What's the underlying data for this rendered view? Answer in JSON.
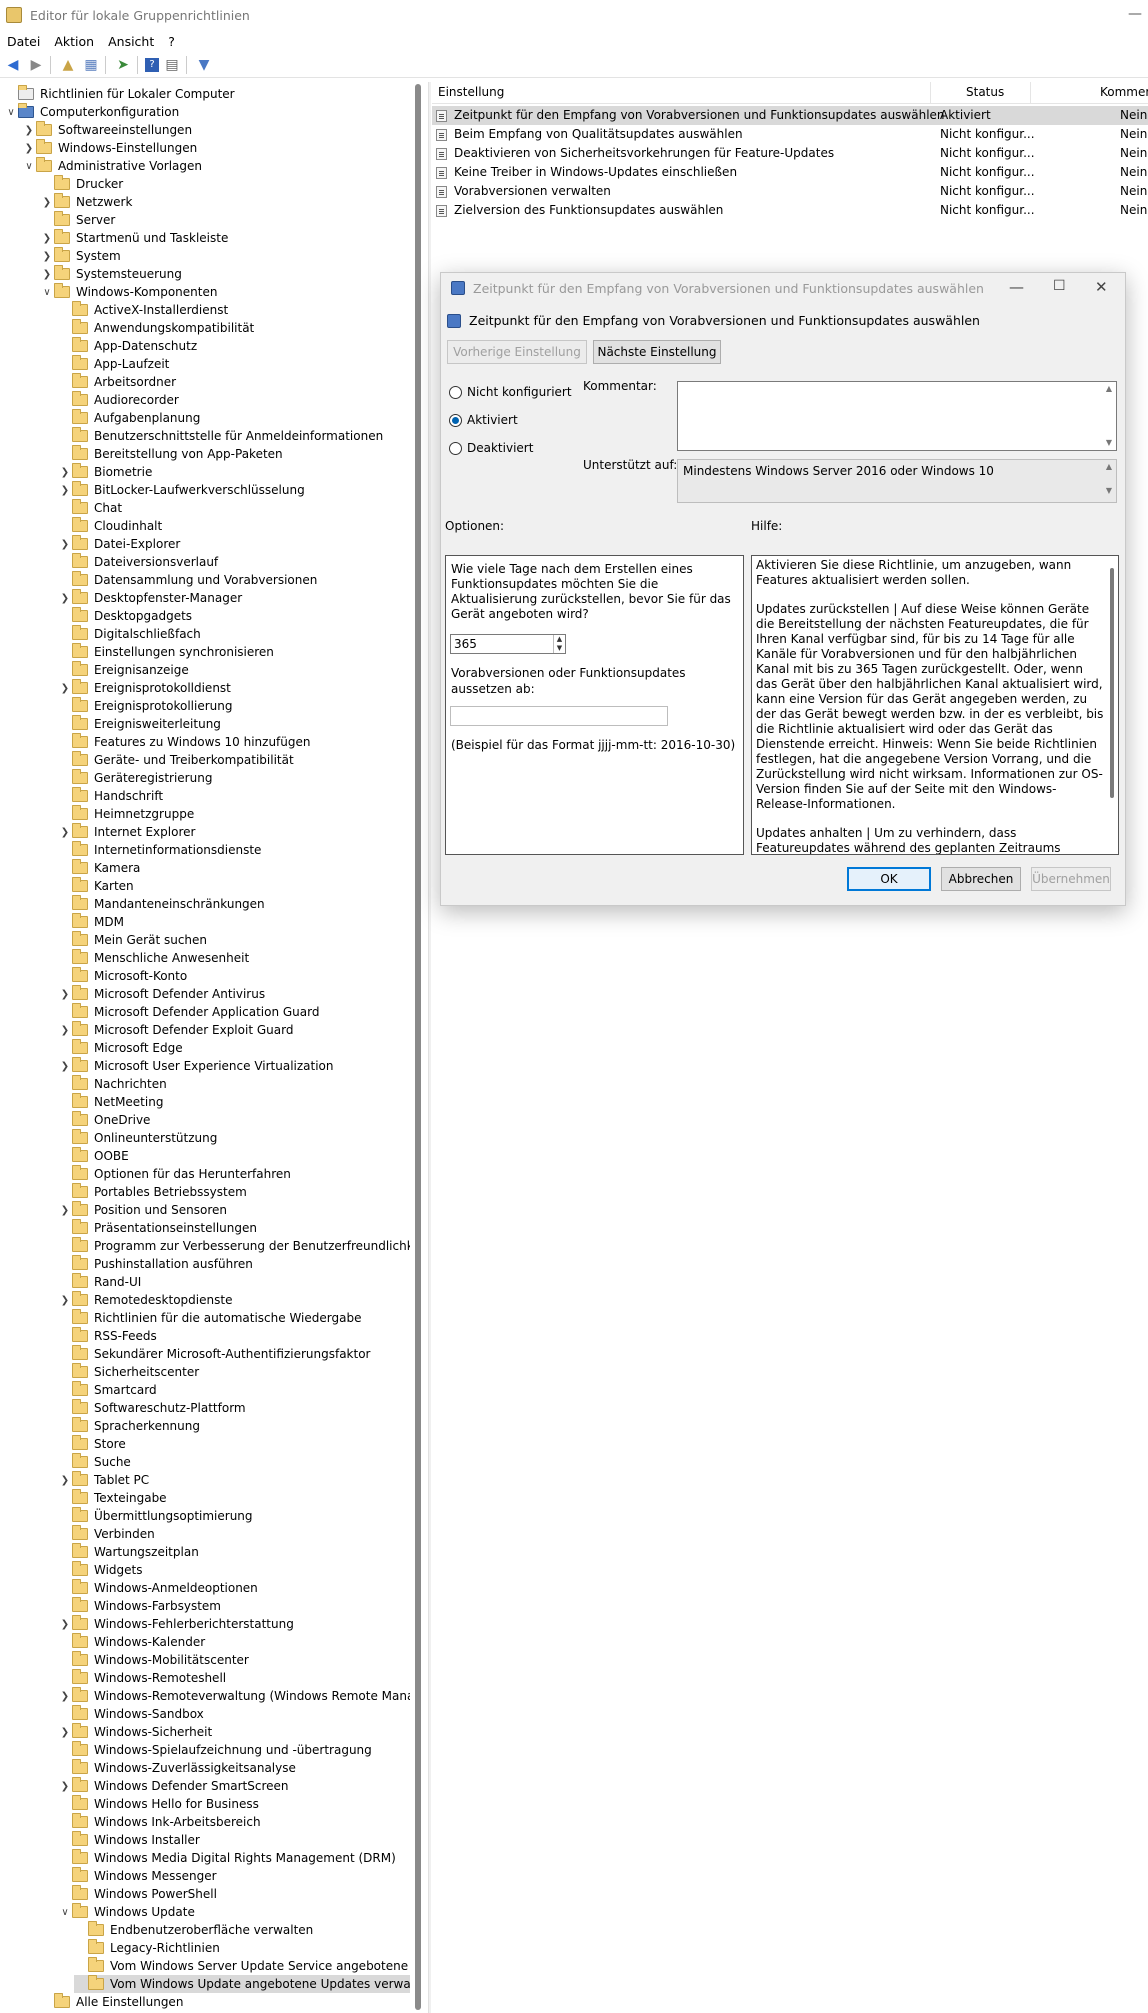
{
  "window": {
    "title": "Editor für lokale Gruppenrichtlinien",
    "minimize": "—"
  },
  "menu": [
    "Datei",
    "Aktion",
    "Ansicht",
    "?"
  ],
  "tree": [
    {
      "label": "Richtlinien für Lokaler Computer",
      "level": 0,
      "arrow": "",
      "icon": "computer-policy"
    },
    {
      "label": "Computerkonfiguration",
      "level": 0,
      "arrow": "v",
      "icon": "computer"
    },
    {
      "label": "Softwareeinstellungen",
      "level": 1,
      "arrow": ">",
      "icon": "folder"
    },
    {
      "label": "Windows-Einstellungen",
      "level": 1,
      "arrow": ">",
      "icon": "folder"
    },
    {
      "label": "Administrative Vorlagen",
      "level": 1,
      "arrow": "v",
      "icon": "folder"
    },
    {
      "label": "Drucker",
      "level": 2,
      "arrow": "",
      "icon": "folder"
    },
    {
      "label": "Netzwerk",
      "level": 2,
      "arrow": ">",
      "icon": "folder"
    },
    {
      "label": "Server",
      "level": 2,
      "arrow": "",
      "icon": "folder"
    },
    {
      "label": "Startmenü und Taskleiste",
      "level": 2,
      "arrow": ">",
      "icon": "folder"
    },
    {
      "label": "System",
      "level": 2,
      "arrow": ">",
      "icon": "folder"
    },
    {
      "label": "Systemsteuerung",
      "level": 2,
      "arrow": ">",
      "icon": "folder"
    },
    {
      "label": "Windows-Komponenten",
      "level": 2,
      "arrow": "v",
      "icon": "folder"
    },
    {
      "label": "ActiveX-Installerdienst",
      "level": 3,
      "arrow": "",
      "icon": "folder"
    },
    {
      "label": "Anwendungskompatibilität",
      "level": 3,
      "arrow": "",
      "icon": "folder"
    },
    {
      "label": "App-Datenschutz",
      "level": 3,
      "arrow": "",
      "icon": "folder"
    },
    {
      "label": "App-Laufzeit",
      "level": 3,
      "arrow": "",
      "icon": "folder"
    },
    {
      "label": "Arbeitsordner",
      "level": 3,
      "arrow": "",
      "icon": "folder"
    },
    {
      "label": "Audiorecorder",
      "level": 3,
      "arrow": "",
      "icon": "folder"
    },
    {
      "label": "Aufgabenplanung",
      "level": 3,
      "arrow": "",
      "icon": "folder"
    },
    {
      "label": "Benutzerschnittstelle für Anmeldeinformationen",
      "level": 3,
      "arrow": "",
      "icon": "folder"
    },
    {
      "label": "Bereitstellung von App-Paketen",
      "level": 3,
      "arrow": "",
      "icon": "folder"
    },
    {
      "label": "Biometrie",
      "level": 3,
      "arrow": ">",
      "icon": "folder"
    },
    {
      "label": "BitLocker-Laufwerkverschlüsselung",
      "level": 3,
      "arrow": ">",
      "icon": "folder"
    },
    {
      "label": "Chat",
      "level": 3,
      "arrow": "",
      "icon": "folder"
    },
    {
      "label": "Cloudinhalt",
      "level": 3,
      "arrow": "",
      "icon": "folder"
    },
    {
      "label": "Datei-Explorer",
      "level": 3,
      "arrow": ">",
      "icon": "folder"
    },
    {
      "label": "Dateiversionsverlauf",
      "level": 3,
      "arrow": "",
      "icon": "folder"
    },
    {
      "label": "Datensammlung und Vorabversionen",
      "level": 3,
      "arrow": "",
      "icon": "folder"
    },
    {
      "label": "Desktopfenster-Manager",
      "level": 3,
      "arrow": ">",
      "icon": "folder"
    },
    {
      "label": "Desktopgadgets",
      "level": 3,
      "arrow": "",
      "icon": "folder"
    },
    {
      "label": "Digitalschließfach",
      "level": 3,
      "arrow": "",
      "icon": "folder"
    },
    {
      "label": "Einstellungen synchronisieren",
      "level": 3,
      "arrow": "",
      "icon": "folder"
    },
    {
      "label": "Ereignisanzeige",
      "level": 3,
      "arrow": "",
      "icon": "folder"
    },
    {
      "label": "Ereignisprotokolldienst",
      "level": 3,
      "arrow": ">",
      "icon": "folder"
    },
    {
      "label": "Ereignisprotokollierung",
      "level": 3,
      "arrow": "",
      "icon": "folder"
    },
    {
      "label": "Ereignisweiterleitung",
      "level": 3,
      "arrow": "",
      "icon": "folder"
    },
    {
      "label": "Features zu Windows 10 hinzufügen",
      "level": 3,
      "arrow": "",
      "icon": "folder"
    },
    {
      "label": "Geräte- und Treiberkompatibilität",
      "level": 3,
      "arrow": "",
      "icon": "folder"
    },
    {
      "label": "Geräteregistrierung",
      "level": 3,
      "arrow": "",
      "icon": "folder"
    },
    {
      "label": "Handschrift",
      "level": 3,
      "arrow": "",
      "icon": "folder"
    },
    {
      "label": "Heimnetzgruppe",
      "level": 3,
      "arrow": "",
      "icon": "folder"
    },
    {
      "label": "Internet Explorer",
      "level": 3,
      "arrow": ">",
      "icon": "folder"
    },
    {
      "label": "Internetinformationsdienste",
      "level": 3,
      "arrow": "",
      "icon": "folder"
    },
    {
      "label": "Kamera",
      "level": 3,
      "arrow": "",
      "icon": "folder"
    },
    {
      "label": "Karten",
      "level": 3,
      "arrow": "",
      "icon": "folder"
    },
    {
      "label": "Mandanteneinschränkungen",
      "level": 3,
      "arrow": "",
      "icon": "folder"
    },
    {
      "label": "MDM",
      "level": 3,
      "arrow": "",
      "icon": "folder"
    },
    {
      "label": "Mein Gerät suchen",
      "level": 3,
      "arrow": "",
      "icon": "folder"
    },
    {
      "label": "Menschliche Anwesenheit",
      "level": 3,
      "arrow": "",
      "icon": "folder"
    },
    {
      "label": "Microsoft-Konto",
      "level": 3,
      "arrow": "",
      "icon": "folder"
    },
    {
      "label": "Microsoft Defender Antivirus",
      "level": 3,
      "arrow": ">",
      "icon": "folder"
    },
    {
      "label": "Microsoft Defender Application Guard",
      "level": 3,
      "arrow": "",
      "icon": "folder"
    },
    {
      "label": "Microsoft Defender Exploit Guard",
      "level": 3,
      "arrow": ">",
      "icon": "folder"
    },
    {
      "label": "Microsoft Edge",
      "level": 3,
      "arrow": "",
      "icon": "folder"
    },
    {
      "label": "Microsoft User Experience Virtualization",
      "level": 3,
      "arrow": ">",
      "icon": "folder"
    },
    {
      "label": "Nachrichten",
      "level": 3,
      "arrow": "",
      "icon": "folder"
    },
    {
      "label": "NetMeeting",
      "level": 3,
      "arrow": "",
      "icon": "folder"
    },
    {
      "label": "OneDrive",
      "level": 3,
      "arrow": "",
      "icon": "folder"
    },
    {
      "label": "Onlineunterstützung",
      "level": 3,
      "arrow": "",
      "icon": "folder"
    },
    {
      "label": "OOBE",
      "level": 3,
      "arrow": "",
      "icon": "folder"
    },
    {
      "label": "Optionen für das Herunterfahren",
      "level": 3,
      "arrow": "",
      "icon": "folder"
    },
    {
      "label": "Portables Betriebssystem",
      "level": 3,
      "arrow": "",
      "icon": "folder"
    },
    {
      "label": "Position und Sensoren",
      "level": 3,
      "arrow": ">",
      "icon": "folder"
    },
    {
      "label": "Präsentationseinstellungen",
      "level": 3,
      "arrow": "",
      "icon": "folder"
    },
    {
      "label": "Programm zur Verbesserung der Benutzerfreundlichkeit",
      "level": 3,
      "arrow": "",
      "icon": "folder"
    },
    {
      "label": "Pushinstallation ausführen",
      "level": 3,
      "arrow": "",
      "icon": "folder"
    },
    {
      "label": "Rand-UI",
      "level": 3,
      "arrow": "",
      "icon": "folder"
    },
    {
      "label": "Remotedesktopdienste",
      "level": 3,
      "arrow": ">",
      "icon": "folder"
    },
    {
      "label": "Richtlinien für die automatische Wiedergabe",
      "level": 3,
      "arrow": "",
      "icon": "folder"
    },
    {
      "label": "RSS-Feeds",
      "level": 3,
      "arrow": "",
      "icon": "folder"
    },
    {
      "label": "Sekundärer Microsoft-Authentifizierungsfaktor",
      "level": 3,
      "arrow": "",
      "icon": "folder"
    },
    {
      "label": "Sicherheitscenter",
      "level": 3,
      "arrow": "",
      "icon": "folder"
    },
    {
      "label": "Smartcard",
      "level": 3,
      "arrow": "",
      "icon": "folder"
    },
    {
      "label": "Softwareschutz-Plattform",
      "level": 3,
      "arrow": "",
      "icon": "folder"
    },
    {
      "label": "Spracherkennung",
      "level": 3,
      "arrow": "",
      "icon": "folder"
    },
    {
      "label": "Store",
      "level": 3,
      "arrow": "",
      "icon": "folder"
    },
    {
      "label": "Suche",
      "level": 3,
      "arrow": "",
      "icon": "folder"
    },
    {
      "label": "Tablet PC",
      "level": 3,
      "arrow": ">",
      "icon": "folder"
    },
    {
      "label": "Texteingabe",
      "level": 3,
      "arrow": "",
      "icon": "folder"
    },
    {
      "label": "Übermittlungsoptimierung",
      "level": 3,
      "arrow": "",
      "icon": "folder"
    },
    {
      "label": "Verbinden",
      "level": 3,
      "arrow": "",
      "icon": "folder"
    },
    {
      "label": "Wartungszeitplan",
      "level": 3,
      "arrow": "",
      "icon": "folder"
    },
    {
      "label": "Widgets",
      "level": 3,
      "arrow": "",
      "icon": "folder"
    },
    {
      "label": "Windows-Anmeldeoptionen",
      "level": 3,
      "arrow": "",
      "icon": "folder"
    },
    {
      "label": "Windows-Farbsystem",
      "level": 3,
      "arrow": "",
      "icon": "folder"
    },
    {
      "label": "Windows-Fehlerberichterstattung",
      "level": 3,
      "arrow": ">",
      "icon": "folder"
    },
    {
      "label": "Windows-Kalender",
      "level": 3,
      "arrow": "",
      "icon": "folder"
    },
    {
      "label": "Windows-Mobilitätscenter",
      "level": 3,
      "arrow": "",
      "icon": "folder"
    },
    {
      "label": "Windows-Remoteshell",
      "level": 3,
      "arrow": "",
      "icon": "folder"
    },
    {
      "label": "Windows-Remoteverwaltung (Windows Remote Managem",
      "level": 3,
      "arrow": ">",
      "icon": "folder"
    },
    {
      "label": "Windows-Sandbox",
      "level": 3,
      "arrow": "",
      "icon": "folder"
    },
    {
      "label": "Windows-Sicherheit",
      "level": 3,
      "arrow": ">",
      "icon": "folder"
    },
    {
      "label": "Windows-Spielaufzeichnung und -übertragung",
      "level": 3,
      "arrow": "",
      "icon": "folder"
    },
    {
      "label": "Windows-Zuverlässigkeitsanalyse",
      "level": 3,
      "arrow": "",
      "icon": "folder"
    },
    {
      "label": "Windows Defender SmartScreen",
      "level": 3,
      "arrow": ">",
      "icon": "folder"
    },
    {
      "label": "Windows Hello for Business",
      "level": 3,
      "arrow": "",
      "icon": "folder"
    },
    {
      "label": "Windows Ink-Arbeitsbereich",
      "level": 3,
      "arrow": "",
      "icon": "folder"
    },
    {
      "label": "Windows Installer",
      "level": 3,
      "arrow": "",
      "icon": "folder"
    },
    {
      "label": "Windows Media Digital Rights Management (DRM)",
      "level": 3,
      "arrow": "",
      "icon": "folder"
    },
    {
      "label": "Windows Messenger",
      "level": 3,
      "arrow": "",
      "icon": "folder"
    },
    {
      "label": "Windows PowerShell",
      "level": 3,
      "arrow": "",
      "icon": "folder"
    },
    {
      "label": "Windows Update",
      "level": 3,
      "arrow": "v",
      "icon": "folder"
    },
    {
      "label": "Endbenutzeroberfläche verwalten",
      "level": 4,
      "arrow": "",
      "icon": "folder"
    },
    {
      "label": "Legacy-Richtlinien",
      "level": 4,
      "arrow": "",
      "icon": "folder"
    },
    {
      "label": "Vom Windows Server Update Service angebotene Updat",
      "level": 4,
      "arrow": "",
      "icon": "folder"
    },
    {
      "label": "Vom Windows Update angebotene Updates verwalten",
      "level": 4,
      "arrow": "",
      "icon": "folder",
      "selected": true
    },
    {
      "label": "Alle Einstellungen",
      "level": 2,
      "arrow": "",
      "icon": "settings-folder"
    }
  ],
  "list": {
    "headers": {
      "setting": "Einstellung",
      "status": "Status",
      "comment": "Kommer"
    },
    "rows": [
      {
        "name": "Zeitpunkt für den Empfang von Vorabversionen und Funktionsupdates auswählen",
        "status": "Aktiviert",
        "comment": "Nein",
        "selected": true
      },
      {
        "name": "Beim Empfang von Qualitätsupdates auswählen",
        "status": "Nicht konfigur...",
        "comment": "Nein"
      },
      {
        "name": "Deaktivieren von Sicherheitsvorkehrungen für Feature-Updates",
        "status": "Nicht konfigur...",
        "comment": "Nein"
      },
      {
        "name": "Keine Treiber in Windows-Updates einschließen",
        "status": "Nicht konfigur...",
        "comment": "Nein"
      },
      {
        "name": "Vorabversionen verwalten",
        "status": "Nicht konfigur...",
        "comment": "Nein"
      },
      {
        "name": "Zielversion des Funktionsupdates auswählen",
        "status": "Nicht konfigur...",
        "comment": "Nein"
      }
    ]
  },
  "dialog": {
    "title": "Zeitpunkt für den Empfang von Vorabversionen und Funktionsupdates auswählen",
    "heading": "Zeitpunkt für den Empfang von Vorabversionen und Funktionsupdates auswählen",
    "prev_button": "Vorherige Einstellung",
    "next_button": "Nächste Einstellung",
    "radio_not_configured": "Nicht konfiguriert",
    "radio_enabled": "Aktiviert",
    "radio_disabled": "Deaktiviert",
    "selected_state": "Aktiviert",
    "comment_label": "Kommentar:",
    "comment_value": "",
    "supported_label": "Unterstützt auf:",
    "supported_value": "Mindestens Windows Server 2016 oder Windows 10",
    "options_label": "Optionen:",
    "help_label": "Hilfe:",
    "option_days_question": "Wie viele Tage nach dem Erstellen eines Funktionsupdates möchten Sie die Aktualisierung zurückstellen, bevor Sie für das Gerät angeboten wird?",
    "option_days_value": "365",
    "option_pause_label": "Vorabversionen oder Funktionsupdates aussetzen ab:",
    "option_pause_value": "",
    "option_format_hint": "(Beispiel für das Format jjjj-mm-tt: 2016-10-30)",
    "help_paragraphs": [
      "Aktivieren Sie diese Richtlinie, um anzugeben, wann Features aktualisiert werden sollen.",
      "Updates zurückstellen | Auf diese Weise können Geräte die Bereitstellung der nächsten Featureupdates, die für Ihren Kanal verfügbar sind, für bis zu 14 Tage für alle Kanäle für Vorabversionen und für den halbjährlichen Kanal mit bis zu 365 Tagen zurückgestellt. Oder, wenn das Gerät über den halbjährlichen Kanal aktualisiert wird, kann eine Version für das Gerät angegeben werden, zu der das Gerät bewegt werden bzw. in der es verbleibt, bis die Richtlinie aktualisiert wird oder das Gerät das Dienstende erreicht. Hinweis: Wenn Sie beide Richtlinien festlegen, hat die angegebene Version Vorrang, und die Zurückstellung wird nicht wirksam. Informationen zur OS-Version finden Sie auf der Seite mit den Windows-Release-Informationen.",
      "Updates anhalten | Um zu verhindern, dass Featureupdates während des geplanten Zeitraums empfangen werden, können Sie die Featureupdates vorübergehend anhalten. Die Pause gilt"
    ],
    "ok_button": "OK",
    "cancel_button": "Abbrechen",
    "apply_button": "Übernehmen"
  },
  "colors": {
    "selection": "#d9d9d9",
    "accent": "#0078d7",
    "dialog_bg": "#f0f0f0"
  }
}
